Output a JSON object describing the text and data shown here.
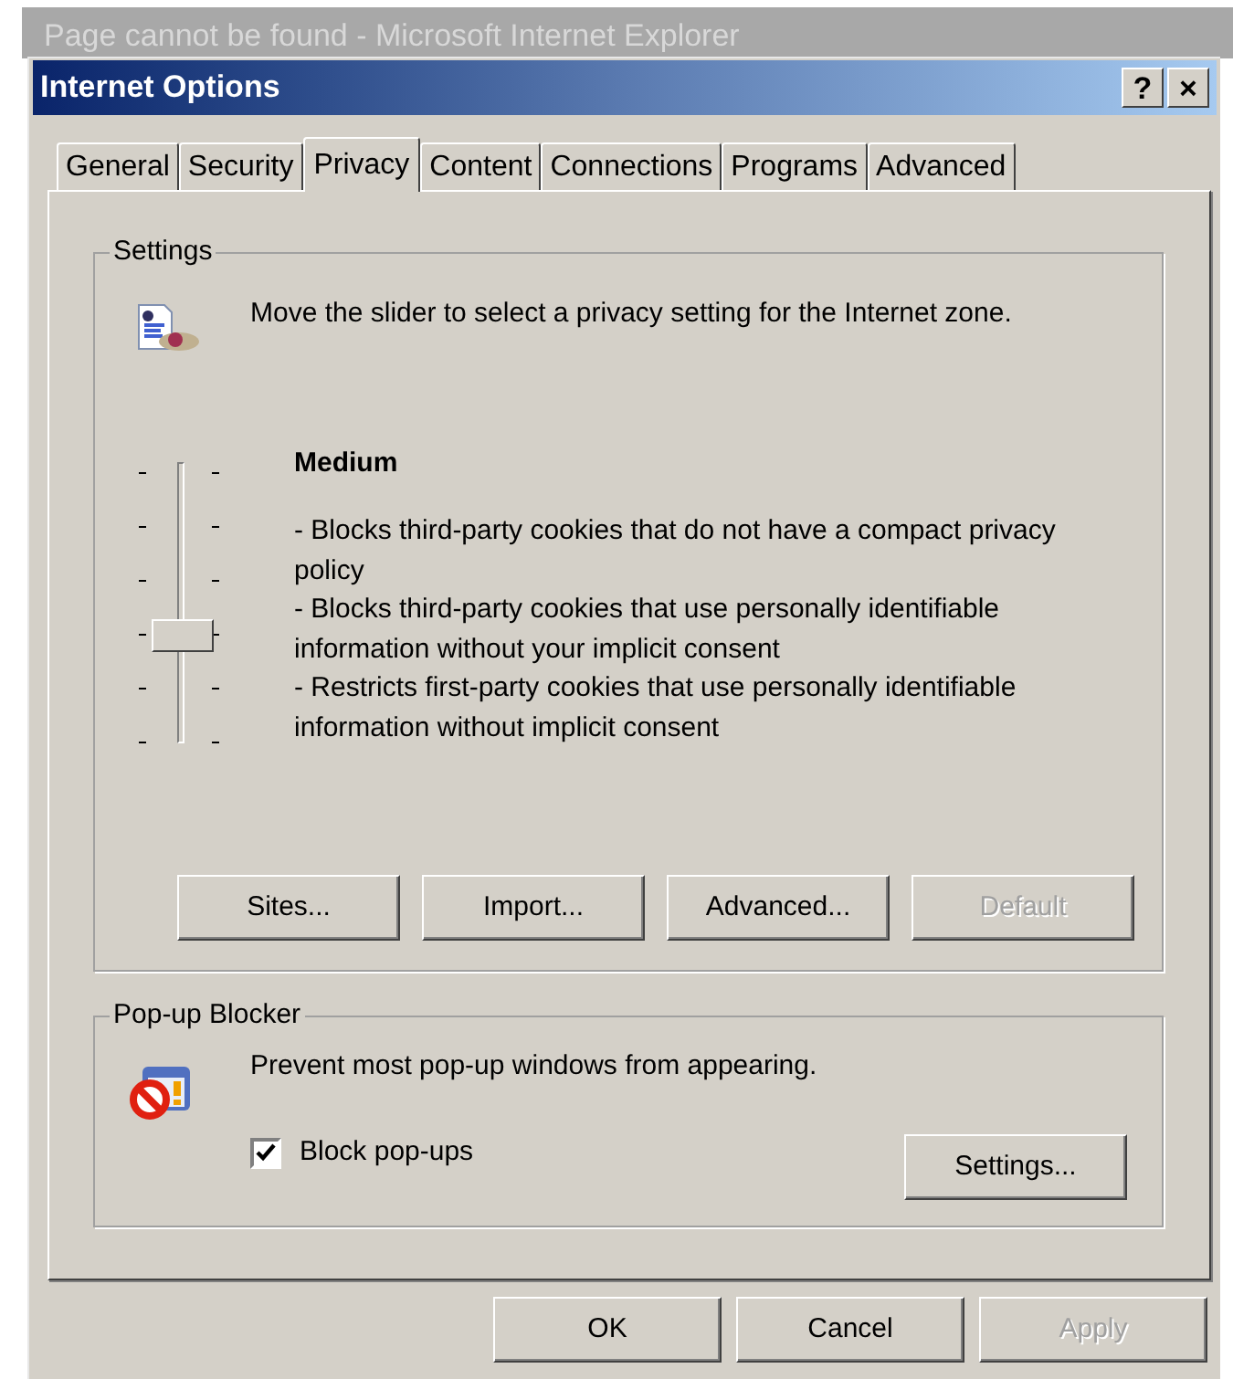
{
  "background_window": {
    "title": "Page cannot be found - Microsoft Internet Explorer"
  },
  "window": {
    "title": "Internet Options",
    "title_buttons": [
      "?",
      "×"
    ]
  },
  "tabs": [
    {
      "label": "General",
      "selected": false
    },
    {
      "label": "Security",
      "selected": false
    },
    {
      "label": "Privacy",
      "selected": true
    },
    {
      "label": "Content",
      "selected": false
    },
    {
      "label": "Connections",
      "selected": false
    },
    {
      "label": "Programs",
      "selected": false
    },
    {
      "label": "Advanced",
      "selected": false
    }
  ],
  "settings": {
    "legend": "Settings",
    "intro": "Move the slider to select a privacy setting for the Internet zone.",
    "slider": {
      "level": 0.4
    },
    "level_name": "Medium",
    "description": [
      "- Blocks third-party cookies that do not have a compact privacy policy",
      "- Blocks third-party cookies that use personally identifiable information without your implicit consent",
      "- Restricts first-party cookies that use personally identifiable information without implicit consent"
    ],
    "buttons": [
      {
        "label": "Sites...",
        "disabled": false
      },
      {
        "label": "Import...",
        "disabled": false
      },
      {
        "label": "Advanced...",
        "disabled": false
      },
      {
        "label": "Default",
        "disabled": true
      }
    ]
  },
  "popup_blocker": {
    "legend": "Pop-up Blocker",
    "intro": "Prevent most pop-up windows from appearing.",
    "checkbox": {
      "label": "Block pop-ups",
      "checked": true
    },
    "button": {
      "label": "Settings...",
      "disabled": false
    }
  },
  "footer_buttons": [
    {
      "label": "OK",
      "disabled": false
    },
    {
      "label": "Cancel",
      "disabled": false
    },
    {
      "label": "Apply",
      "disabled": true
    }
  ]
}
